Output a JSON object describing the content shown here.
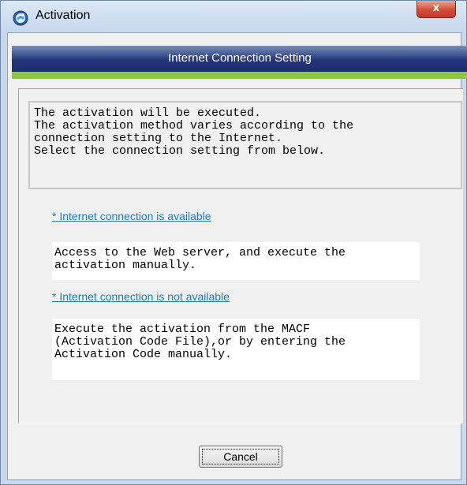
{
  "window": {
    "title": "Activation",
    "icon": "activation-globe-icon",
    "close_glyph": "x"
  },
  "banner": {
    "title": "Internet Connection Setting",
    "accent_color": "#8dc63f",
    "bar_color": "#25357a"
  },
  "intro": {
    "lines": "The activation will be executed.\nThe activation method varies according to the\nconnection setting to the Internet.\nSelect the connection setting from below."
  },
  "options": [
    {
      "link": "* Internet connection is available",
      "description": "Access to the Web server, and execute the\nactivation manually."
    },
    {
      "link": "* Internet connection is not available",
      "description": "Execute the activation from the MACF\n(Activation Code File),or by entering the\nActivation Code manually."
    }
  ],
  "buttons": {
    "cancel_label": "Cancel"
  }
}
